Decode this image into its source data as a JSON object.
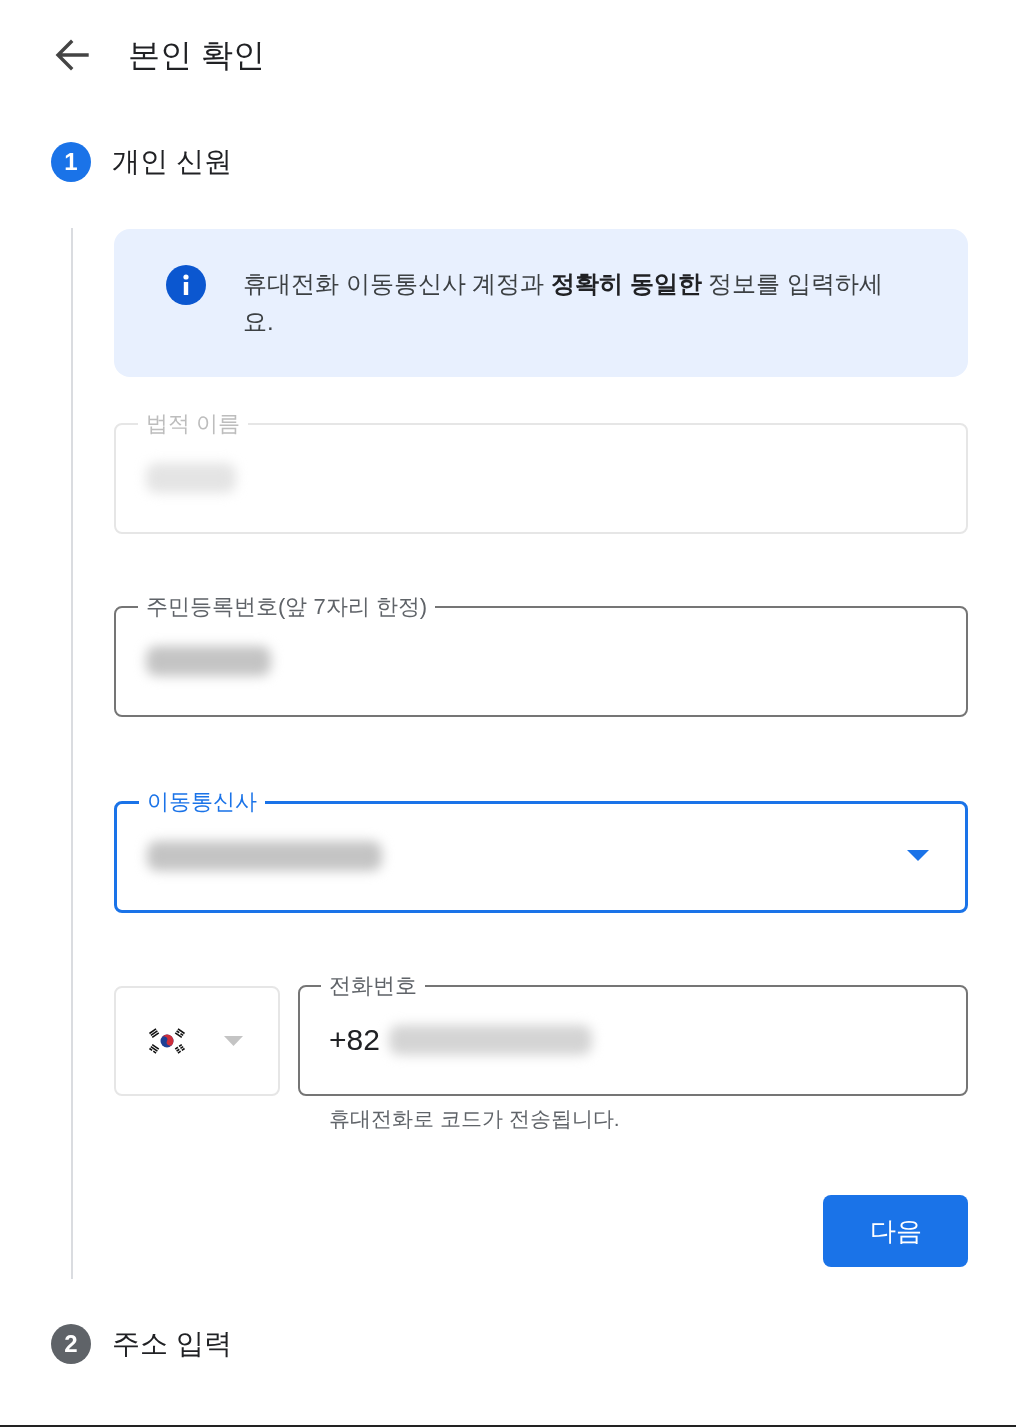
{
  "header": {
    "title": "본인 확인"
  },
  "steps": [
    {
      "number": "1",
      "title": "개인 신원",
      "active": true,
      "info": {
        "text": "휴대전화 이동통신사 계정과 **정확히 동일한** 정보를 입력하세요."
      },
      "fields": [
        {
          "kind": "text",
          "label": "법적 이름",
          "disabled": true,
          "focused": false,
          "value_hidden": true
        },
        {
          "kind": "text",
          "label": "주민등록번호(앞 7자리 한정)",
          "disabled": false,
          "focused": false,
          "value_hidden": true
        },
        {
          "kind": "select",
          "label": "이동통신사",
          "disabled": false,
          "focused": true,
          "value_hidden": true
        }
      ],
      "phone": {
        "country_disabled": true,
        "label": "전화번호",
        "prefix": "+82",
        "value_hidden": true,
        "helper": "휴대전화로 코드가 전송됩니다."
      },
      "next_button": {
        "label": "다음"
      }
    },
    {
      "number": "2",
      "title": "주소 입력",
      "active": false
    }
  ]
}
